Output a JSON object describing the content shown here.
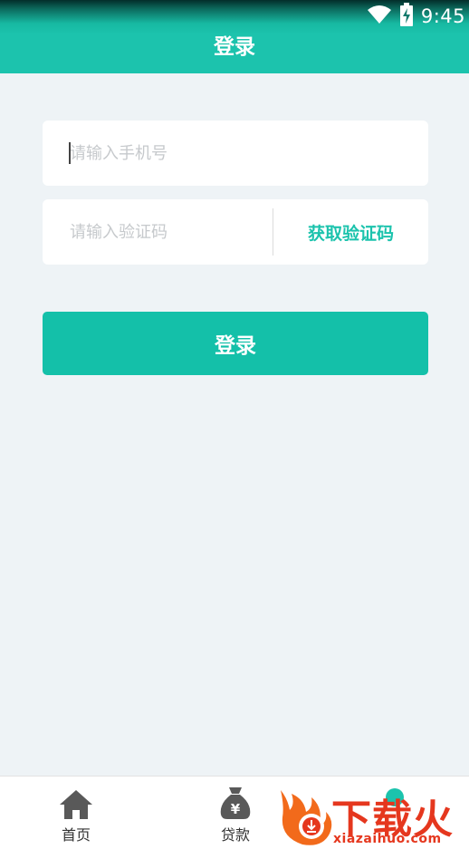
{
  "status_bar": {
    "time": "9:45",
    "icons": [
      "wifi-icon",
      "battery-charging-icon"
    ]
  },
  "header": {
    "title": "登录"
  },
  "form": {
    "phone_placeholder": "请输入手机号",
    "code_placeholder": "请输入验证码",
    "get_code_label": "获取验证码",
    "login_label": "登录"
  },
  "tabbar": {
    "items": [
      {
        "label": "首页",
        "icon": "home-icon"
      },
      {
        "label": "贷款",
        "icon": "money-bag-icon"
      },
      {
        "label": "",
        "icon": "user-icon"
      }
    ]
  },
  "watermark": {
    "title": "下载火",
    "url": "xiazaihuo.com"
  },
  "colors": {
    "accent": "#1cc3ad",
    "background": "#eef3f6",
    "watermark": "#e5371e"
  }
}
